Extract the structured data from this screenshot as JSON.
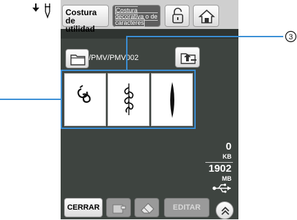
{
  "header": {
    "utility_label": "Costura de utilidad",
    "decorative_label": "Costura decorativa o de caracteres"
  },
  "file_browser": {
    "path": "/PMV/PMV002",
    "patterns": [
      {
        "name": "pattern-1"
      },
      {
        "name": "pattern-2"
      },
      {
        "name": "pattern-3"
      }
    ]
  },
  "memory": {
    "used_value": "0",
    "used_unit": "KB",
    "free_value": "1902",
    "free_unit": "MB"
  },
  "footer": {
    "close_label": "CERRAR",
    "edit_label": "EDITAR"
  },
  "callouts": {
    "label_3": "3"
  },
  "colors": {
    "panel_bg": "#3e4440",
    "selection_border": "#3a8fd6"
  },
  "icons": [
    "needle-icon",
    "lock-icon",
    "home-icon",
    "folder-icon",
    "folder-up-icon",
    "save-to-memory-icon",
    "delete-icon",
    "usb-icon",
    "chevron-up-icon"
  ]
}
